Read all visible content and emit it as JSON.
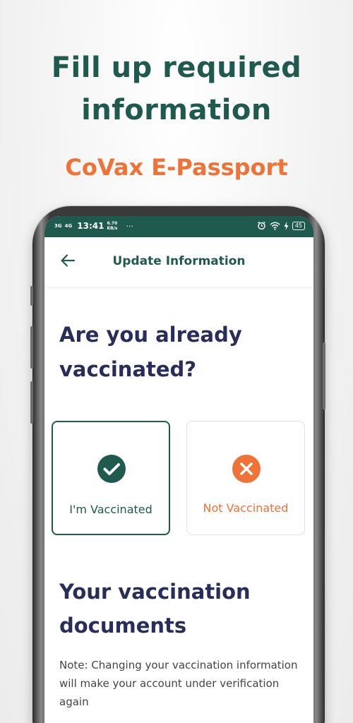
{
  "headline": {
    "line1": "Fill up required",
    "line2": "information"
  },
  "subhead": "CoVax E-Passport",
  "status_bar": {
    "signal1": "3G",
    "signal2": "4G",
    "time": "13:41",
    "speed_value": "6.70",
    "speed_unit": "KB/s",
    "more": "···",
    "battery": "45"
  },
  "app_bar": {
    "back_icon": "arrow-left-icon",
    "title": "Update Information"
  },
  "question": {
    "line1": "Are you already",
    "line2": "vaccinated?"
  },
  "options": [
    {
      "label": "I'm Vaccinated",
      "icon": "check-circle-icon",
      "color": "#1e5a4e",
      "selected": true
    },
    {
      "label": "Not Vaccinated",
      "icon": "x-circle-icon",
      "color": "#f07236",
      "selected": false
    }
  ],
  "documents": {
    "title_line1": "Your vaccination",
    "title_line2": "documents",
    "note": "Note: Changing your vaccination information will make your account under verification again"
  },
  "colors": {
    "brand_green": "#1e5a4e",
    "accent_orange": "#f07236",
    "heading_navy": "#282d5a"
  }
}
